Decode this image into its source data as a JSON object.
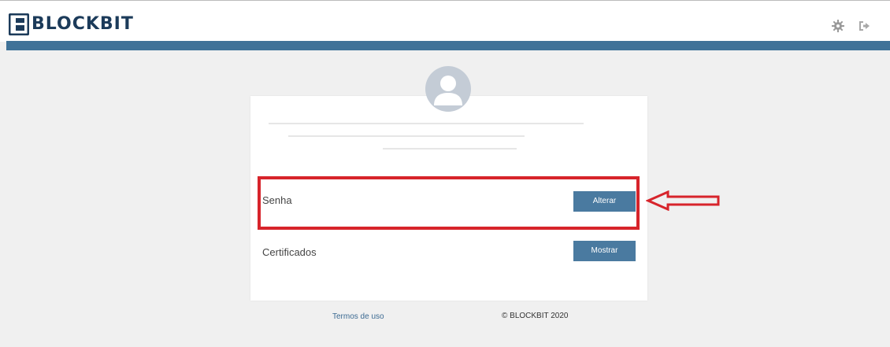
{
  "header": {
    "brand": "BLOCKBIT",
    "icons": [
      "gear-icon",
      "logout-icon"
    ]
  },
  "profile": {
    "avatar": "user-avatar-icon"
  },
  "settings": {
    "password_label": "Senha",
    "password_button": "Alterar",
    "certificates_label": "Certificados",
    "certificates_button": "Mostrar"
  },
  "footer": {
    "terms_link": "Termos de uso",
    "copyright": "© BLOCKBIT 2020"
  },
  "colors": {
    "accent_bar": "#3f7298",
    "button": "#4a7aa0",
    "highlight": "#d7242b",
    "brand": "#1c3b5a"
  }
}
